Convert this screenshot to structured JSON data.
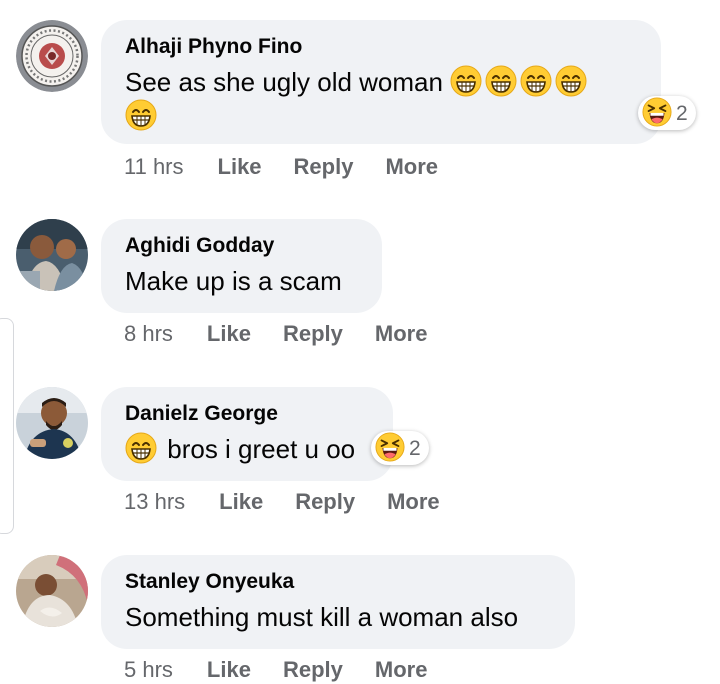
{
  "comments": [
    {
      "author": "Alhaji Phyno Fino",
      "text": "See as she ugly old woman",
      "reaction_count": "2",
      "time": "11 hrs",
      "like_label": "Like",
      "reply_label": "Reply",
      "more_label": "More"
    },
    {
      "author": "Aghidi Godday",
      "text": "Make up is a scam",
      "time": "8 hrs",
      "like_label": "Like",
      "reply_label": "Reply",
      "more_label": "More"
    },
    {
      "author": "Danielz George",
      "text": "bros i greet u oo",
      "reaction_count": "2",
      "time": "13 hrs",
      "like_label": "Like",
      "reply_label": "Reply",
      "more_label": "More"
    },
    {
      "author": "Stanley Onyeuka",
      "text": "Something must kill a woman also",
      "time": "5 hrs",
      "like_label": "Like",
      "reply_label": "Reply",
      "more_label": "More"
    }
  ],
  "icons": {
    "emoji_in_text": "beaming-face-with-smiling-eyes",
    "reaction": "laughing-squinting-face"
  },
  "colors": {
    "bubble_background": "#f0f2f5",
    "secondary_text": "#65676b",
    "primary_text": "#050505",
    "emoji_yellow": "#ffcc33"
  }
}
